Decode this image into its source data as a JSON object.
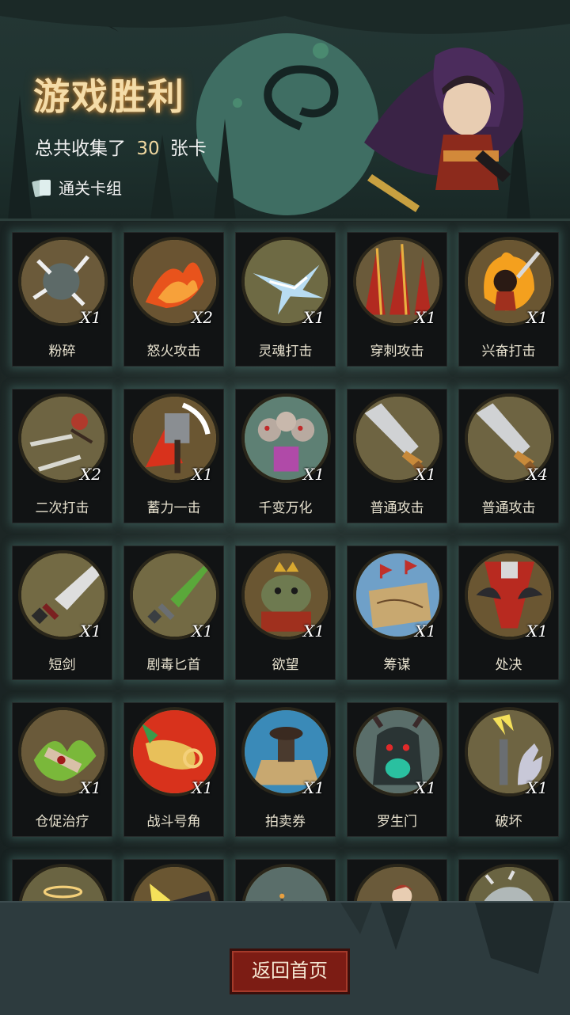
{
  "header": {
    "title": "游戏胜利",
    "collected_prefix": "总共收集了",
    "collected_count": "30",
    "collected_suffix": "张卡",
    "deck_label": "通关卡组"
  },
  "cards": [
    {
      "name": "粉碎",
      "count": "X1",
      "icon": "mace-icon"
    },
    {
      "name": "怒火攻击",
      "count": "X2",
      "icon": "fire-slash-icon"
    },
    {
      "name": "灵魂打击",
      "count": "X1",
      "icon": "ice-shards-icon"
    },
    {
      "name": "穿刺攻击",
      "count": "X1",
      "icon": "spikes-icon"
    },
    {
      "name": "兴奋打击",
      "count": "X1",
      "icon": "flaming-hero-icon"
    },
    {
      "name": "二次打击",
      "count": "X2",
      "icon": "twin-daggers-icon"
    },
    {
      "name": "蓄力一击",
      "count": "X1",
      "icon": "hammer-icon"
    },
    {
      "name": "千变万化",
      "count": "X1",
      "icon": "puppets-icon"
    },
    {
      "name": "普通攻击",
      "count": "X1",
      "icon": "sword-icon"
    },
    {
      "name": "普通攻击",
      "count": "X4",
      "icon": "sword-icon"
    },
    {
      "name": "短剑",
      "count": "X1",
      "icon": "short-sword-icon"
    },
    {
      "name": "剧毒匕首",
      "count": "X1",
      "icon": "poison-dagger-icon"
    },
    {
      "name": "欲望",
      "count": "X1",
      "icon": "toad-king-icon"
    },
    {
      "name": "筹谋",
      "count": "X1",
      "icon": "map-icon"
    },
    {
      "name": "处决",
      "count": "X1",
      "icon": "execution-icon"
    },
    {
      "name": "仓促治疗",
      "count": "X1",
      "icon": "heal-icon"
    },
    {
      "name": "战斗号角",
      "count": "X1",
      "icon": "war-horn-icon"
    },
    {
      "name": "拍卖券",
      "count": "X1",
      "icon": "stamp-icon"
    },
    {
      "name": "罗生门",
      "count": "X1",
      "icon": "demon-gate-icon"
    },
    {
      "name": "破坏",
      "count": "X1",
      "icon": "torch-hand-icon"
    },
    {
      "name": "",
      "count": "",
      "icon": "halo-icon"
    },
    {
      "name": "",
      "count": "",
      "icon": "hammer-strike-icon"
    },
    {
      "name": "",
      "count": "",
      "icon": "hooded-crowd-icon"
    },
    {
      "name": "",
      "count": "",
      "icon": "archer-icon"
    },
    {
      "name": "",
      "count": "",
      "icon": "stone-icon"
    }
  ],
  "footer": {
    "home_label": "返回首页"
  },
  "colors": {
    "title_glow": "#c98b3b",
    "count_highlight": "#f0d8a0",
    "home_button": "#7c1c14",
    "medal_bg": "#7a6d3a"
  }
}
